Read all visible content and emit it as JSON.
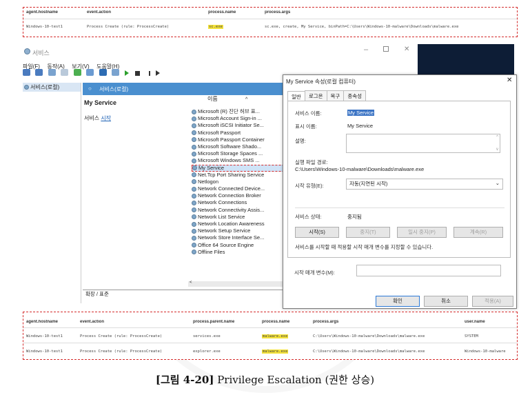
{
  "top_log": {
    "headers": [
      "agent.hostname",
      "event.action",
      "process.name",
      "process.args"
    ],
    "row": [
      "Windows-10-test1",
      "Process Create (rule: ProcessCreate)",
      "sc.exe",
      "sc.exe, create, My Service, binPath=C:\\Users\\Windows-10-malware\\Downloads\\malware.exe"
    ]
  },
  "services_window": {
    "title": "서비스",
    "menu": [
      "파일(F)",
      "동작(A)",
      "보기(V)",
      "도움말(H)"
    ],
    "tree_root": "서비스(로컬)",
    "header_title": "서비스(로컬)",
    "selected_service_name": "My Service",
    "start_link_prefix": "서비스 ",
    "start_link": "시작",
    "list_column": "이름",
    "services": [
      "Microsoft (R) 진단 허브 표...",
      "Microsoft Account Sign-in ...",
      "Microsoft iSCSI Initiator Se...",
      "Microsoft Passport",
      "Microsoft Passport Container",
      "Microsoft Software Shado...",
      "Microsoft Storage Spaces ...",
      "Microsoft Windows SMS ...",
      "My Service",
      "Net.Tcp Port Sharing Service",
      "Netlogon",
      "Network Connected Device...",
      "Network Connection Broker",
      "Network Connections",
      "Network Connectivity Assis...",
      "Network List Service",
      "Network Location Awareness",
      "Network Setup Service",
      "Network Store Interface Se...",
      "Office 64 Source Engine",
      "Offline Files"
    ],
    "bottom_tabs": "확장 / 표준"
  },
  "dialog": {
    "title": "My Service 속성(로컬 컴퓨터)",
    "tabs": [
      "일반",
      "로그온",
      "복구",
      "종속성"
    ],
    "service_name_label": "서비스 이름:",
    "service_name": "My Service",
    "display_name_label": "표시 이름:",
    "display_name": "My Service",
    "description_label": "설명:",
    "exe_path_label": "실행 파일 경로:",
    "exe_path": "C:\\Users\\Windows-10-malware\\Downloads\\malware.exe",
    "startup_type_label": "시작 유형(E):",
    "startup_type": "자동(지연된 시작)",
    "status_label": "서비스 상태:",
    "status": "중지됨",
    "buttons": [
      "시작(S)",
      "중지(T)",
      "일시 중지(P)",
      "계속(R)"
    ],
    "hint": "서비스를 시작할 때 적용할 시작 매개 변수를 지정할 수 있습니다.",
    "param_label": "시작 매개 변수(M):",
    "ok": "확인",
    "cancel": "취소",
    "apply": "적용(A)"
  },
  "bottom_log": {
    "headers": [
      "agent.hostname",
      "event.action",
      "process.parent.name",
      "process.name",
      "process.args",
      "user.name"
    ],
    "rows": [
      [
        "Windows-10-test1",
        "Process Create (rule: ProcessCreate)",
        "services.exe",
        "malware.exe",
        "C:\\Users\\Windows-10-malware\\Downloads\\malware.exe",
        "SYSTEM"
      ],
      [
        "Windows-10-test1",
        "Process Create (rule: ProcessCreate)",
        "explorer.exe",
        "malware.exe",
        "C:\\Users\\Windows-10-malware\\Downloads\\malware.exe",
        "Windows-10-malware"
      ]
    ]
  },
  "caption": {
    "label": "[그림 4-20]",
    "text": " Privilege Escalation (권한 상승)"
  },
  "colors": {
    "dashed_border": "#d42a2a",
    "highlight": "#f4e23a",
    "header_blue": "#4a8fcf"
  }
}
